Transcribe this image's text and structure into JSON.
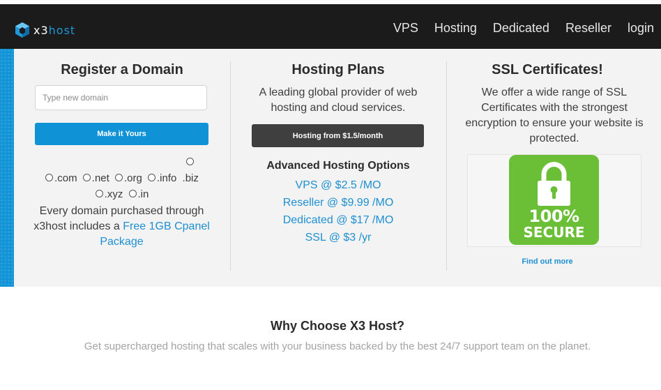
{
  "brand": {
    "logo_prefix": "x3",
    "logo_suffix": "host"
  },
  "nav": {
    "items": [
      {
        "label": "VPS"
      },
      {
        "label": "Hosting"
      },
      {
        "label": "Dedicated"
      },
      {
        "label": "Reseller"
      },
      {
        "label": "login"
      }
    ]
  },
  "domain": {
    "title": "Register a Domain",
    "input_placeholder": "Type new domain",
    "input_value": "",
    "button_label": "Make it Yours",
    "tlds": [
      ".com",
      ".net",
      ".org",
      ".info",
      ".biz",
      ".xyz",
      ".in"
    ],
    "promo_text": "Every domain purchased through x3host includes a",
    "promo_link": "Free 1GB Cpanel Package"
  },
  "hosting": {
    "title": "Hosting Plans",
    "description": "A leading global provider of web hosting and cloud services.",
    "button_label": "Hosting from $1.5/month",
    "options_title": "Advanced Hosting Options",
    "options": [
      {
        "label": "VPS @ $2.5 /MO"
      },
      {
        "label": "Reseller @ $9.99 /MO"
      },
      {
        "label": "Dedicated @ $17 /MO"
      },
      {
        "label": "SSL @ $3 /yr"
      }
    ]
  },
  "ssl": {
    "title": "SSL Certificates!",
    "description": "We offer a wide range of SSL Certificates with the strongest encryption to ensure your website is protected.",
    "badge_line1": "100%",
    "badge_line2": "SECURE",
    "link_label": "Find out more"
  },
  "why": {
    "title": "Why Choose X3 Host?",
    "subtitle": "Get supercharged hosting that scales with your business backed by the best 24/7 support team on the planet."
  },
  "colors": {
    "accent": "#1093d6",
    "nav_bg": "#1b1b1b",
    "badge": "#6bbf37",
    "dark_button": "#3f3f3f"
  }
}
